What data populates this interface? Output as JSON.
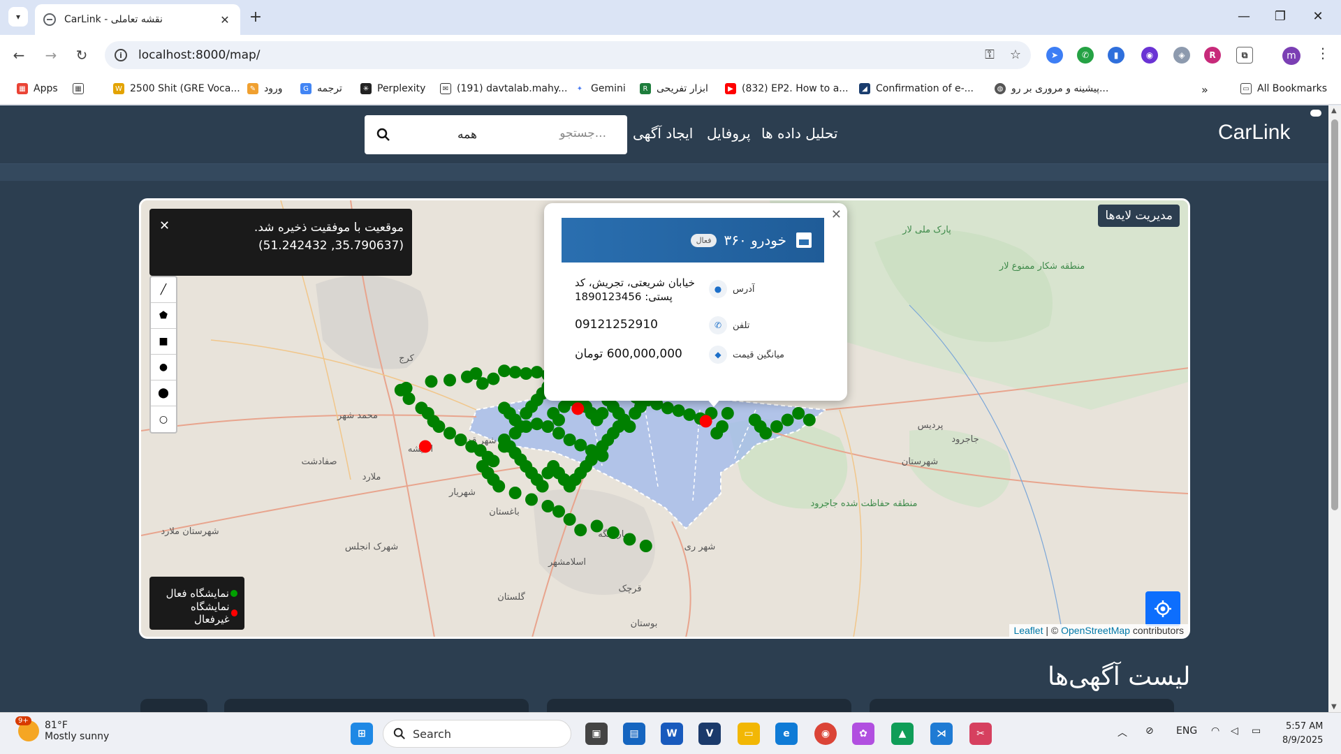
{
  "browser": {
    "tab_title": "CarLink - نقشه تعاملی",
    "url": "localhost:8000/map/",
    "profile_initial": "m",
    "bookmarks": [
      {
        "label": "Apps"
      },
      {
        "label": "2500 Shit (GRE Voca..."
      },
      {
        "label": "ورود"
      },
      {
        "label": "ترجمه"
      },
      {
        "label": "Perplexity"
      },
      {
        "label": "(191) davtalab.mahy..."
      },
      {
        "label": "Gemini"
      },
      {
        "label": "ابزار تفریحی"
      },
      {
        "label": "(832) EP2. How to a..."
      },
      {
        "label": "Confirmation of e-..."
      },
      {
        "label": "پیشینه و مروری بر رو..."
      },
      {
        "label": "All Bookmarks"
      }
    ]
  },
  "navbar": {
    "brand": "CarLink",
    "links": [
      "تحلیل داده ها",
      "پروفایل",
      "ایجاد آگهی"
    ],
    "search_placeholder": "جستجو...",
    "search_category": "همه"
  },
  "map": {
    "toast": "موقعیت با موفقیت ذخیره شد. (35.790637, 51.242432)",
    "layer_button": "مدیریت لایه‌ها",
    "popup": {
      "title": "خودرو ۳۶۰",
      "status": "فعال",
      "rows": [
        {
          "label": "آدرس",
          "value": "خیابان شریعتی، تجریش، کد پستی: 1890123456"
        },
        {
          "label": "تلفن",
          "value": "09121252910"
        },
        {
          "label": "میانگین قیمت",
          "value": "600,000,000 تومان"
        }
      ]
    },
    "legend": [
      {
        "label": "نمایشگاه فعال",
        "color": "#008000"
      },
      {
        "label": "نمایشگاه غیرفعال",
        "color": "#ff0000"
      }
    ],
    "attribution": {
      "leaflet": "Leaflet",
      "sep": " | © ",
      "osm": "OpenStreetMap",
      "suffix": " contributors"
    },
    "place_labels": [
      "کرج",
      "شهریار",
      "اندیشه",
      "ملارد",
      "باغستان",
      "شهر قدس",
      "اسلامشهر",
      "جهاردانگه",
      "شهر ری",
      "پردیس",
      "گلستان",
      "قرچک",
      "شهرستان",
      "منطقه حفاظت شده جاجرود",
      "پارک ملی لار",
      "منطقه شکار ممنوع لار",
      "بوستان",
      "محمد شهر",
      "جاجرود",
      "شهرستان ملارد",
      "صفادشت",
      "شهرک انجلس"
    ]
  },
  "content": {
    "list_title": "لیست آگهی‌ها"
  },
  "taskbar": {
    "weather_temp": "81°F",
    "weather_desc": "Mostly sunny",
    "weather_badge": "9+",
    "search": "Search",
    "lang": "ENG",
    "time": "5:57 AM",
    "date": "8/9/2025"
  }
}
